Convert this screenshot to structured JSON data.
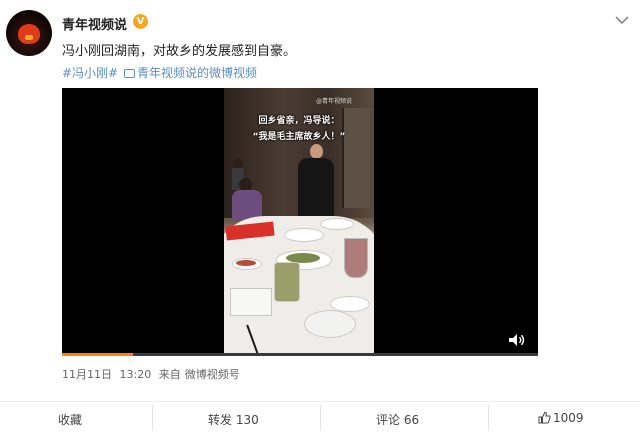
{
  "post": {
    "user_name": "青年视频说",
    "verified_mark": "V",
    "text": "冯小刚回湖南，对故乡的发展感到自豪。",
    "tags": [
      "#冯小刚#",
      "青年视频说的微博视频"
    ],
    "caption_line1": "回乡省亲，冯导说：",
    "caption_line2": "“我是毛主席故乡人！”",
    "watermark": "@青年视频说",
    "video_progress": 0.15
  },
  "meta": {
    "date": "11月11日",
    "time": "13:20",
    "source_prefix": "来自",
    "source": "微博视频号"
  },
  "actions": {
    "collect": "收藏",
    "repost_label": "转发",
    "repost_count": "130",
    "comment_label": "评论",
    "comment_count": "66",
    "like_count": "1009"
  },
  "icons": {
    "more": "chevron-down-icon",
    "video_tag": "video-icon",
    "volume": "volume-icon",
    "like": "thumbs-up-icon"
  },
  "colors": {
    "link": "#5a8fc5",
    "progress": "#ff8200",
    "verified": "#f5a623"
  }
}
